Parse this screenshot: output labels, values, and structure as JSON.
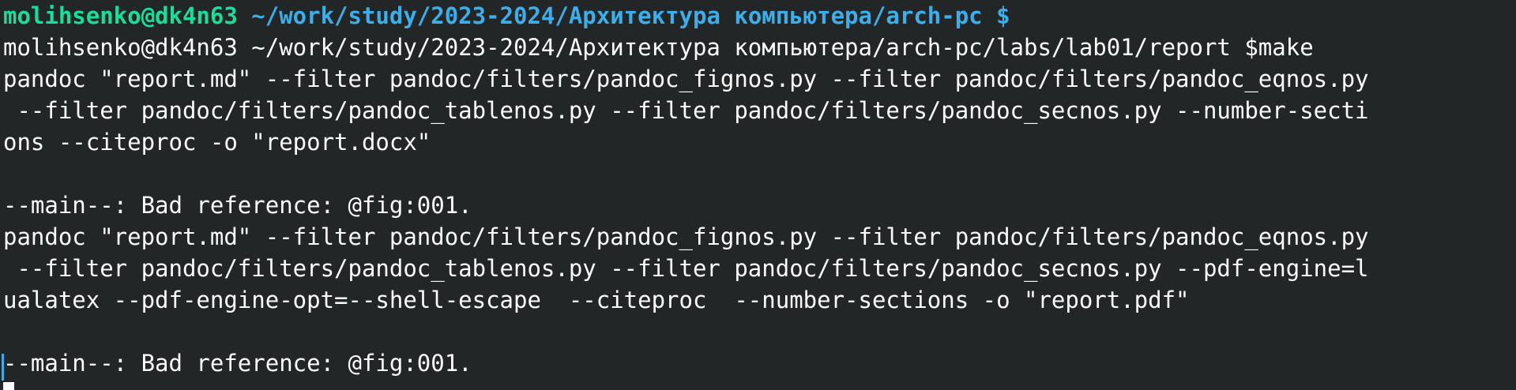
{
  "terminal": {
    "prompt": {
      "user_host": "molihsenko@dk4n63",
      "path": "~/work/study/2023-2024/Архитектура компьютера/arch-pc",
      "sign": "$"
    },
    "lines": [
      "molihsenko@dk4n63 ~/work/study/2023-2024/Архитектура компьютера/arch-pc/labs/lab01/report $make",
      "pandoc \"report.md\" --filter pandoc/filters/pandoc_fignos.py --filter pandoc/filters/pandoc_eqnos.py",
      " --filter pandoc/filters/pandoc_tablenos.py --filter pandoc/filters/pandoc_secnos.py --number-secti",
      "ons --citeproc -o \"report.docx\"",
      "",
      "--main--: Bad reference: @fig:001.",
      "pandoc \"report.md\" --filter pandoc/filters/pandoc_fignos.py --filter pandoc/filters/pandoc_eqnos.py",
      " --filter pandoc/filters/pandoc_tablenos.py --filter pandoc/filters/pandoc_secnos.py --pdf-engine=l",
      "ualatex --pdf-engine-opt=--shell-escape  --citeproc  --number-sections -o \"report.pdf\"",
      "",
      "--main--: Bad reference: @fig:001."
    ],
    "colors": {
      "background": "#232627",
      "foreground": "#fcfcfc",
      "prompt_user": "#1cdc9a",
      "prompt_path": "#3daee9"
    }
  }
}
